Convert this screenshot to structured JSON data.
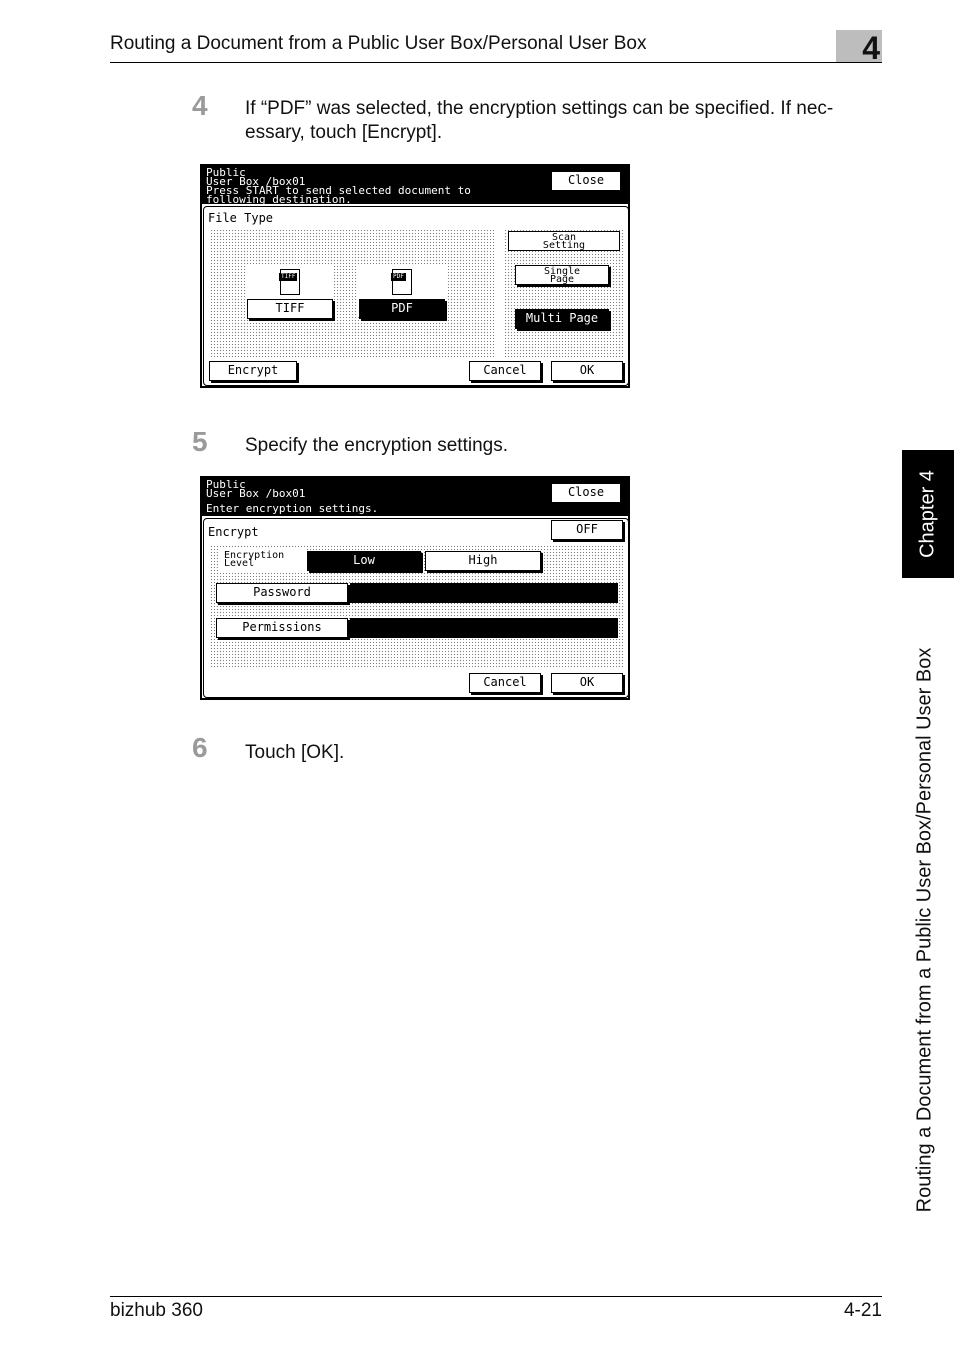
{
  "header": {
    "title": "Routing a Document from a Public User Box/Personal User Box",
    "chapter_number": "4"
  },
  "steps": [
    {
      "number": "4",
      "text": "If “PDF” was selected, the encryption settings can be specified. If nec- essary, touch [Encrypt]."
    },
    {
      "number": "5",
      "text": "Specify the encryption settings."
    },
    {
      "number": "6",
      "text": "Touch [OK]."
    }
  ],
  "screen1": {
    "header_line1": "Public",
    "header_line2": "User Box  /box01",
    "header_line3": "Press START to send selected document to",
    "header_line4": "following destination.",
    "close": "Close",
    "file_type_label": "File Type",
    "tiff_icon": "TIFF",
    "pdf_icon": "PDF",
    "tiff_button": "TIFF",
    "pdf_button": "PDF",
    "scan_setting_line1": "Scan",
    "scan_setting_line2": "Setting",
    "single_page_line1": "Single",
    "single_page_line2": "Page",
    "multi_page": "Multi Page",
    "encrypt": "Encrypt",
    "cancel": "Cancel",
    "ok": "OK"
  },
  "screen2": {
    "header_line1": "Public",
    "header_line2": "User Box  /box01",
    "header_line3": "Enter encryption settings.",
    "close": "Close",
    "encrypt_label": "Encrypt",
    "off": "OFF",
    "level_line1": "Encryption",
    "level_line2": "Level",
    "low": "Low",
    "high": "High",
    "password": "Password",
    "permissions": "Permissions",
    "cancel": "Cancel",
    "ok": "OK"
  },
  "side_tab": {
    "chapter_label": "Chapter 4",
    "section_title": "Routing a Document from a Public User Box/Personal User Box"
  },
  "footer": {
    "product": "bizhub 360",
    "page": "4-21"
  }
}
